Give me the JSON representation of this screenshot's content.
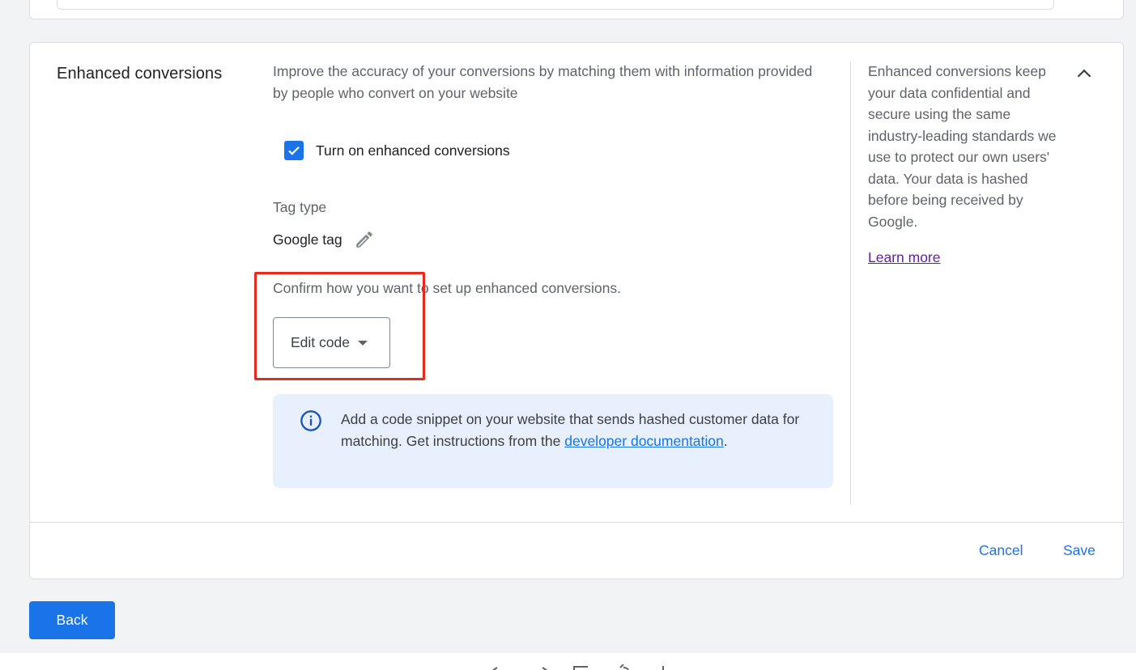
{
  "section": {
    "title": "Enhanced conversions",
    "description": "Improve the accuracy of your conversions by matching them with information provided by people who convert on your website"
  },
  "checkbox": {
    "label": "Turn on enhanced conversions",
    "checked": true
  },
  "tag_type": {
    "label": "Tag type",
    "value": "Google tag",
    "edit_icon": "pencil-icon"
  },
  "setup": {
    "prompt": "Confirm how you want to set up enhanced conversions.",
    "dropdown_value": "Edit code"
  },
  "info": {
    "icon": "info-icon",
    "text_before": "Add a code snippet on your website that sends hashed customer data for matching. Get instructions from the ",
    "link": "developer documentation",
    "text_after": "."
  },
  "sidebar": {
    "text": "Enhanced conversions keep your data confidential and secure using the same industry-leading standards we use to protect our own users' data. Your data is hashed before being received by Google.",
    "learn_more": "Learn more",
    "collapse_icon": "chevron-up-icon"
  },
  "footer": {
    "cancel": "Cancel",
    "save": "Save"
  },
  "back_button": "Back",
  "colors": {
    "primary": "#1a73e8",
    "highlight": "#e8291c",
    "info_bg": "#e8f0fe",
    "visited_link": "#681da8"
  }
}
